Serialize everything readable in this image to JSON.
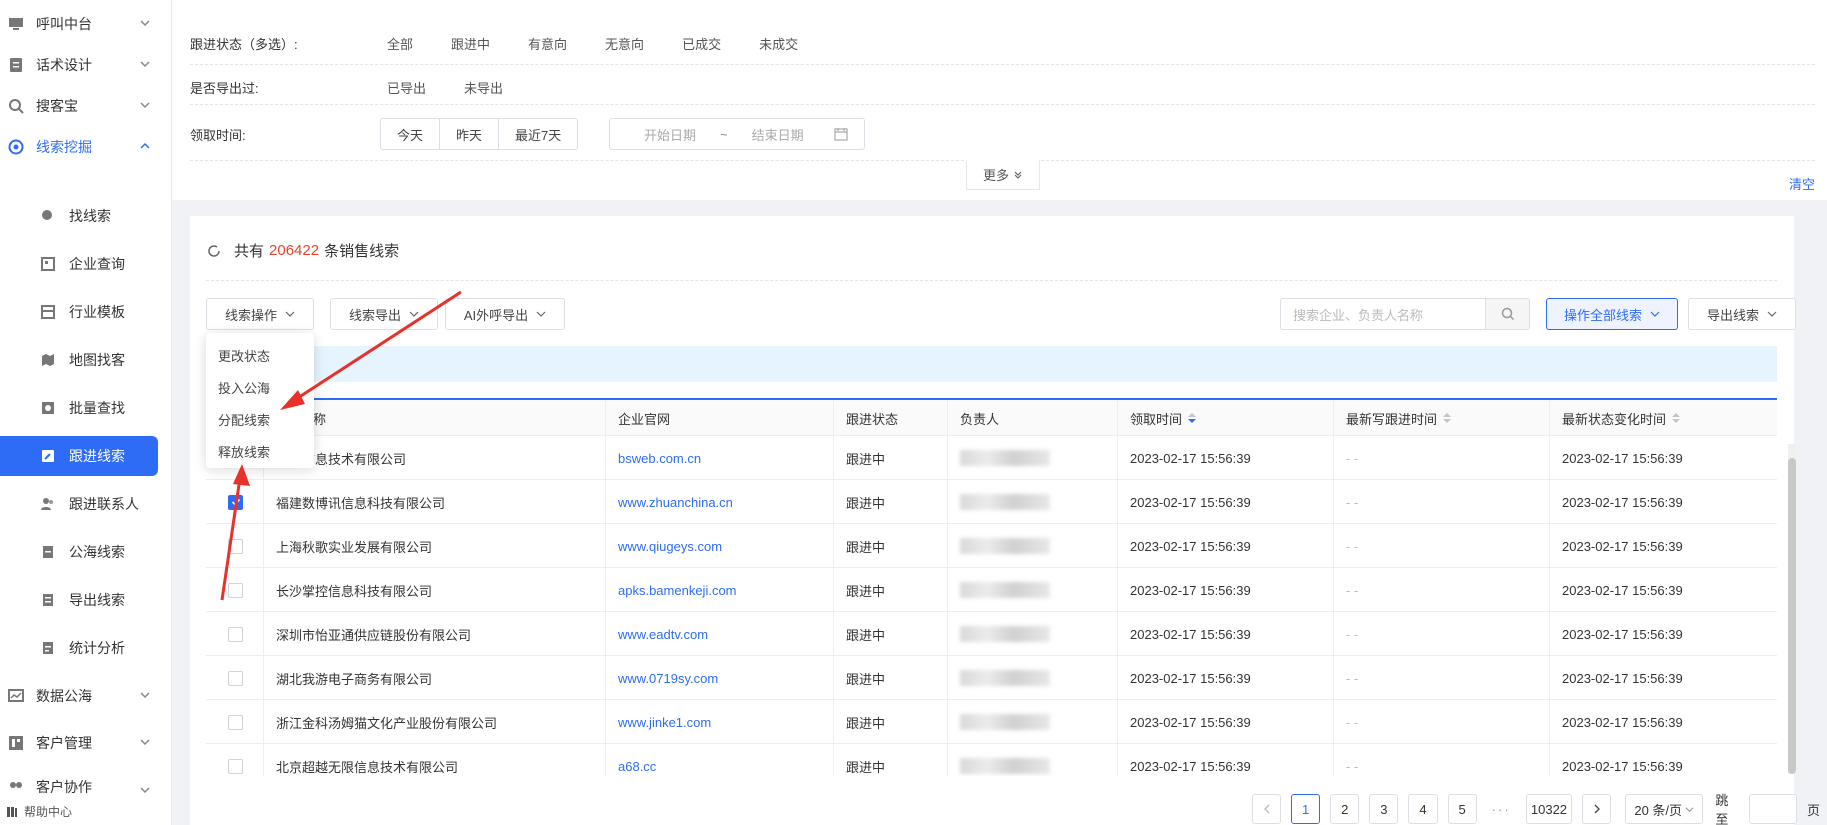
{
  "sidebar": {
    "items": [
      {
        "label": "呼叫中台",
        "icon": "monitor-icon"
      },
      {
        "label": "话术设计",
        "icon": "script-icon"
      },
      {
        "label": "搜客宝",
        "icon": "search-people-icon"
      },
      {
        "label": "线索挖掘",
        "icon": "target-icon"
      }
    ],
    "subitems": [
      {
        "label": "找线索"
      },
      {
        "label": "企业查询"
      },
      {
        "label": "行业模板"
      },
      {
        "label": "地图找客"
      },
      {
        "label": "批量查找"
      },
      {
        "label": "跟进线索"
      },
      {
        "label": "跟进联系人"
      },
      {
        "label": "公海线索"
      },
      {
        "label": "导出线索"
      },
      {
        "label": "统计分析"
      }
    ],
    "bottom_items": [
      {
        "label": "数据公海"
      },
      {
        "label": "客户管理"
      },
      {
        "label": "客户协作"
      }
    ],
    "help": "帮助中心"
  },
  "filters": {
    "status_label": "跟进状态（多选）:",
    "status_options": [
      "全部",
      "跟进中",
      "有意向",
      "无意向",
      "已成交",
      "未成交"
    ],
    "export_label": "是否导出过:",
    "export_options": [
      "已导出",
      "未导出"
    ],
    "time_label": "领取时间:",
    "time_options": [
      "今天",
      "昨天",
      "最近7天"
    ],
    "start_placeholder": "开始日期",
    "range_sep": "~",
    "end_placeholder": "结束日期",
    "more": "更多",
    "clear": "清空"
  },
  "summary": {
    "prefix": "共有",
    "count": "206422",
    "suffix": "条销售线索"
  },
  "toolbar": {
    "ops": "线索操作",
    "export": "线索导出",
    "ai_export": "AI外呼导出",
    "search_placeholder": "搜索企业、负责人名称",
    "op_all": "操作全部线索",
    "export_leads": "导出线索"
  },
  "dropdown": [
    "更改状态",
    "投入公海",
    "分配线索",
    "释放线索"
  ],
  "table": {
    "headers": [
      "全称",
      "企业官网",
      "跟进状态",
      "负责人",
      "领取时间",
      "最新写跟进时间",
      "最新状态变化时间"
    ],
    "rows": [
      {
        "name": "博杉信息技术有限公司",
        "site": "bsweb.com.cn",
        "status": "跟进中",
        "time": "2023-02-17 15:56:39",
        "last": "- -",
        "change": "2023-02-17 15:56:39",
        "checked": true
      },
      {
        "name": "福建数博讯信息科技有限公司",
        "site": "www.zhuanchina.cn",
        "status": "跟进中",
        "time": "2023-02-17 15:56:39",
        "last": "- -",
        "change": "2023-02-17 15:56:39",
        "checked": true
      },
      {
        "name": "上海秋歌实业发展有限公司",
        "site": "www.qiugeys.com",
        "status": "跟进中",
        "time": "2023-02-17 15:56:39",
        "last": "- -",
        "change": "2023-02-17 15:56:39",
        "checked": false
      },
      {
        "name": "长沙掌控信息科技有限公司",
        "site": "apks.bamenkeji.com",
        "status": "跟进中",
        "time": "2023-02-17 15:56:39",
        "last": "- -",
        "change": "2023-02-17 15:56:39",
        "checked": false
      },
      {
        "name": "深圳市怡亚通供应链股份有限公司",
        "site": "www.eadtv.com",
        "status": "跟进中",
        "time": "2023-02-17 15:56:39",
        "last": "- -",
        "change": "2023-02-17 15:56:39",
        "checked": false
      },
      {
        "name": "湖北我游电子商务有限公司",
        "site": "www.0719sy.com",
        "status": "跟进中",
        "time": "2023-02-17 15:56:39",
        "last": "- -",
        "change": "2023-02-17 15:56:39",
        "checked": false
      },
      {
        "name": "浙江金科汤姆猫文化产业股份有限公司",
        "site": "www.jinke1.com",
        "status": "跟进中",
        "time": "2023-02-17 15:56:39",
        "last": "- -",
        "change": "2023-02-17 15:56:39",
        "checked": false
      },
      {
        "name": "北京超越无限信息技术有限公司",
        "site": "a68.cc",
        "status": "跟进中",
        "time": "2023-02-17 15:56:39",
        "last": "- -",
        "change": "2023-02-17 15:56:39",
        "checked": false
      }
    ]
  },
  "pagination": {
    "pages": [
      "1",
      "2",
      "3",
      "4",
      "5"
    ],
    "dots": "···",
    "last": "10322",
    "page_size": "20 条/页",
    "goto": "跳至",
    "page_unit": "页"
  },
  "colors": {
    "accent": "#2e6cf6",
    "annotation": "#e8312a",
    "count": "#e8412c"
  }
}
